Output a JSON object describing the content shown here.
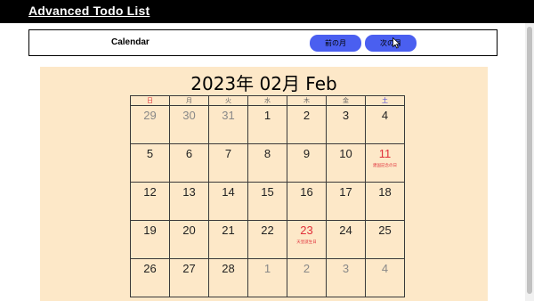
{
  "header": {
    "title": "Advanced Todo List"
  },
  "toolbar": {
    "label": "Calendar",
    "prev_label": "前の月",
    "next_label": "次の月"
  },
  "calendar": {
    "title": "2023年 02月 Feb",
    "weekdays": [
      "日",
      "月",
      "火",
      "水",
      "木",
      "金",
      "土"
    ],
    "weeks": [
      [
        {
          "d": "29",
          "t": "other"
        },
        {
          "d": "30",
          "t": "other"
        },
        {
          "d": "31",
          "t": "other"
        },
        {
          "d": "1",
          "t": "cur"
        },
        {
          "d": "2",
          "t": "cur"
        },
        {
          "d": "3",
          "t": "cur"
        },
        {
          "d": "4",
          "t": "cur"
        }
      ],
      [
        {
          "d": "5",
          "t": "cur"
        },
        {
          "d": "6",
          "t": "cur"
        },
        {
          "d": "7",
          "t": "cur"
        },
        {
          "d": "8",
          "t": "cur"
        },
        {
          "d": "9",
          "t": "cur"
        },
        {
          "d": "10",
          "t": "cur"
        },
        {
          "d": "11",
          "t": "holiday",
          "h": "建国記念の日"
        }
      ],
      [
        {
          "d": "12",
          "t": "cur"
        },
        {
          "d": "13",
          "t": "cur"
        },
        {
          "d": "14",
          "t": "cur"
        },
        {
          "d": "15",
          "t": "cur"
        },
        {
          "d": "16",
          "t": "cur"
        },
        {
          "d": "17",
          "t": "cur"
        },
        {
          "d": "18",
          "t": "cur"
        }
      ],
      [
        {
          "d": "19",
          "t": "cur"
        },
        {
          "d": "20",
          "t": "cur"
        },
        {
          "d": "21",
          "t": "cur"
        },
        {
          "d": "22",
          "t": "cur"
        },
        {
          "d": "23",
          "t": "holiday",
          "h": "天皇誕生日"
        },
        {
          "d": "24",
          "t": "cur"
        },
        {
          "d": "25",
          "t": "cur"
        }
      ],
      [
        {
          "d": "26",
          "t": "cur"
        },
        {
          "d": "27",
          "t": "cur"
        },
        {
          "d": "28",
          "t": "cur"
        },
        {
          "d": "1",
          "t": "other"
        },
        {
          "d": "2",
          "t": "other"
        },
        {
          "d": "3",
          "t": "other"
        },
        {
          "d": "4",
          "t": "other"
        }
      ]
    ]
  },
  "colors": {
    "header_bg": "#000000",
    "calendar_bg": "#fde8c8",
    "button": "#4a5ff0",
    "holiday": "#e0303a",
    "saturday": "#3b3bd6"
  },
  "icons": {
    "cursor": "mouse-pointer-icon"
  }
}
